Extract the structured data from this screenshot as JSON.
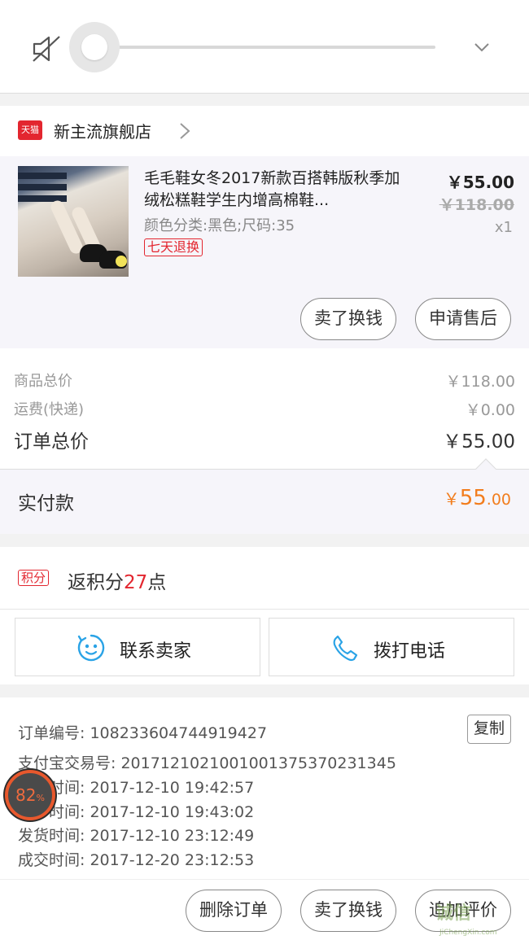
{
  "volume": {
    "level": 0.0,
    "muted": true
  },
  "shop": {
    "badge": "天猫",
    "name": "新主流旗舰店"
  },
  "product": {
    "title": "毛毛鞋女冬2017新款百搭韩版秋季加绒松糕鞋学生内增高棉鞋...",
    "variant": "颜色分类:黑色;尺码:35",
    "return_tag": "七天退换",
    "price_now": "￥55.00",
    "price_original": "￥118.00",
    "quantity": "x1",
    "buttons": {
      "sell_exchange": "卖了换钱",
      "after_sales": "申请售后"
    }
  },
  "summary": {
    "goods_total_label": "商品总价",
    "goods_total_value": "￥118.00",
    "shipping_label": "运费(快递)",
    "shipping_value": "￥0.00",
    "order_total_label": "订单总价",
    "order_total_value": "￥55.00"
  },
  "paid": {
    "label": "实付款",
    "currency": "￥",
    "integer": "55",
    "decimal": ".00"
  },
  "points": {
    "badge": "积分",
    "prefix": "返积分",
    "count": "27",
    "suffix": "点"
  },
  "contact": {
    "seller": "联系卖家",
    "phone": "拨打电话"
  },
  "order_info": {
    "order_no": "订单编号: 108233604744919427",
    "copy": "复制",
    "alipay_no": "支付宝交易号: 2017121021001001375370231345",
    "created": "时间: 2017-12-10 19:42:57",
    "paid": "时间: 2017-12-10 19:43:02",
    "shipped": "发货时间: 2017-12-10 23:12:49",
    "completed": "成交时间: 2017-12-20 23:12:53"
  },
  "bottom_actions": {
    "delete": "删除订单",
    "sell_exchange": "卖了换钱",
    "review": "追加评价"
  },
  "float_widget": {
    "value": "82",
    "unit": "%"
  },
  "watermark": {
    "main": "诚信",
    "sub": "JiChengXin.com"
  },
  "colors": {
    "accent_red": "#e3262f",
    "price_orange": "#f27d1d",
    "contact_blue": "#2aa3e6"
  }
}
